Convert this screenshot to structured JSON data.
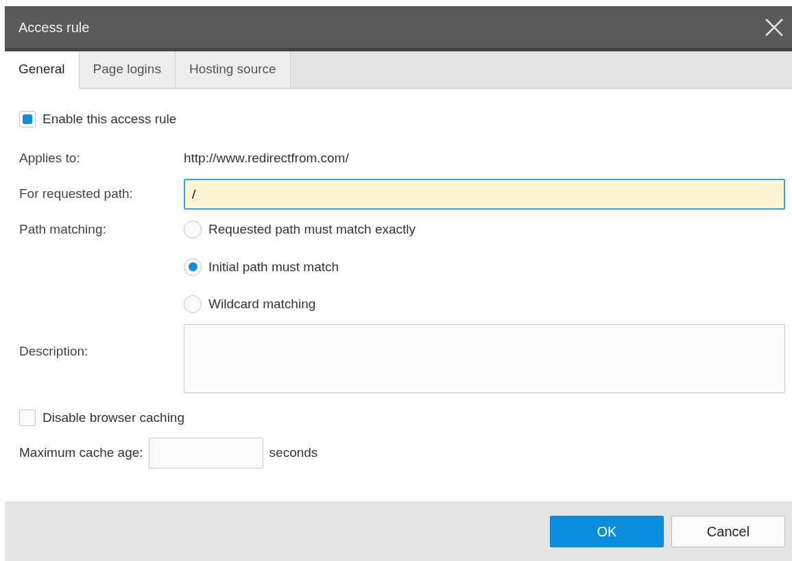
{
  "window": {
    "title": "Access rule"
  },
  "tabs": [
    {
      "label": "General",
      "selected": true
    },
    {
      "label": "Page logins",
      "selected": false
    },
    {
      "label": "Hosting source",
      "selected": false
    }
  ],
  "enable_rule": {
    "label": "Enable this access rule",
    "checked": true
  },
  "applies_to": {
    "label": "Applies to:",
    "value": "http://www.redirectfrom.com/"
  },
  "requested_path": {
    "label": "For requested path:",
    "value": "/",
    "focused": true
  },
  "path_matching": {
    "label": "Path matching:",
    "options": [
      {
        "label": "Requested path must match exactly",
        "selected": false
      },
      {
        "label": "Initial path must match",
        "selected": true
      },
      {
        "label": "Wildcard matching",
        "selected": false
      }
    ]
  },
  "description": {
    "label": "Description:"
  },
  "disable_caching": {
    "label": "Disable browser caching",
    "checked": false
  },
  "max_cache_age": {
    "label": "Maximum cache age:",
    "unit": "seconds"
  },
  "buttons": [
    {
      "label": "OK",
      "kind": "primary"
    },
    {
      "label": "Cancel",
      "kind": "secondary"
    }
  ]
}
